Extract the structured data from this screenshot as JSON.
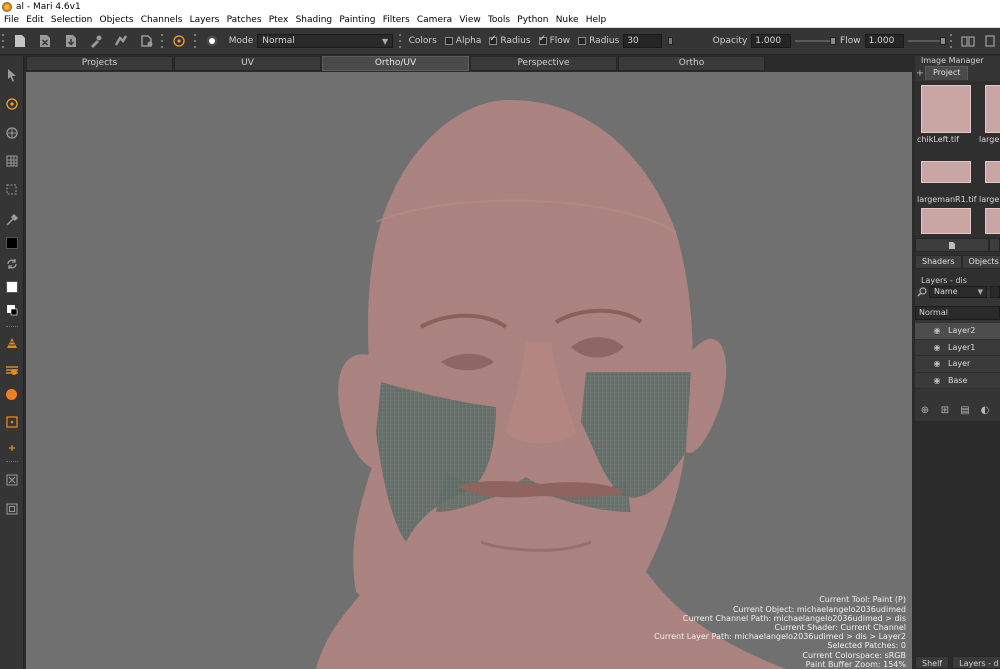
{
  "window": {
    "title": "al - Mari 4.6v1"
  },
  "menu": [
    "File",
    "Edit",
    "Selection",
    "Objects",
    "Channels",
    "Layers",
    "Patches",
    "Ptex",
    "Shading",
    "Painting",
    "Filters",
    "Camera",
    "View",
    "Tools",
    "Python",
    "Nuke",
    "Help"
  ],
  "toolbar": {
    "mode_label": "Mode",
    "mode_value": "Normal",
    "colors_label": "Colors",
    "alpha_label": "Alpha",
    "alpha_checked": false,
    "radius_check_label": "Radius",
    "radius_checked": true,
    "flow_check_label": "Flow",
    "flow_checked": true,
    "radius_label": "Radius",
    "radius_value": "30",
    "opacity_label": "Opacity",
    "opacity_value": "1.000",
    "flow_label": "Flow",
    "flow_value": "1.000",
    "accent_color": "#f0a030"
  },
  "viewport_tabs": [
    {
      "label": "Projects",
      "active": false
    },
    {
      "label": "UV",
      "active": false
    },
    {
      "label": "Ortho/UV",
      "active": true
    },
    {
      "label": "Perspective",
      "active": false
    },
    {
      "label": "Ortho",
      "active": false
    }
  ],
  "status": {
    "tool": "Current Tool: Paint (P)",
    "object": "Current Object: michaelangelo2036udimed",
    "channel_path": "Current Channel Path: michaelangelo2036udimed > dis",
    "shader": "Current Shader: Current Channel",
    "layer_path": "Current Layer Path: michaelangelo2036udimed > dis > Layer2",
    "patches": "Selected Patches: 0",
    "colorspace": "Current Colorspace: sRGB",
    "zoom": "Paint Buffer Zoom: 154%"
  },
  "image_manager": {
    "title": "Image Manager",
    "tab": "Project",
    "images": [
      "chikLeft.tif",
      "large",
      "largemanR1.tif",
      "large"
    ]
  },
  "shaders_objects_tabs": [
    "Shaders",
    "Objects"
  ],
  "layers_panel": {
    "title": "Layers - dis",
    "search_field": "Name",
    "blend_mode": "Normal",
    "layers": [
      {
        "name": "Layer2",
        "selected": true
      },
      {
        "name": "Layer1",
        "selected": false
      },
      {
        "name": "Layer",
        "selected": false
      },
      {
        "name": "Base",
        "selected": false
      }
    ]
  },
  "bottom_tabs": [
    "Shelf",
    "Layers - d"
  ]
}
